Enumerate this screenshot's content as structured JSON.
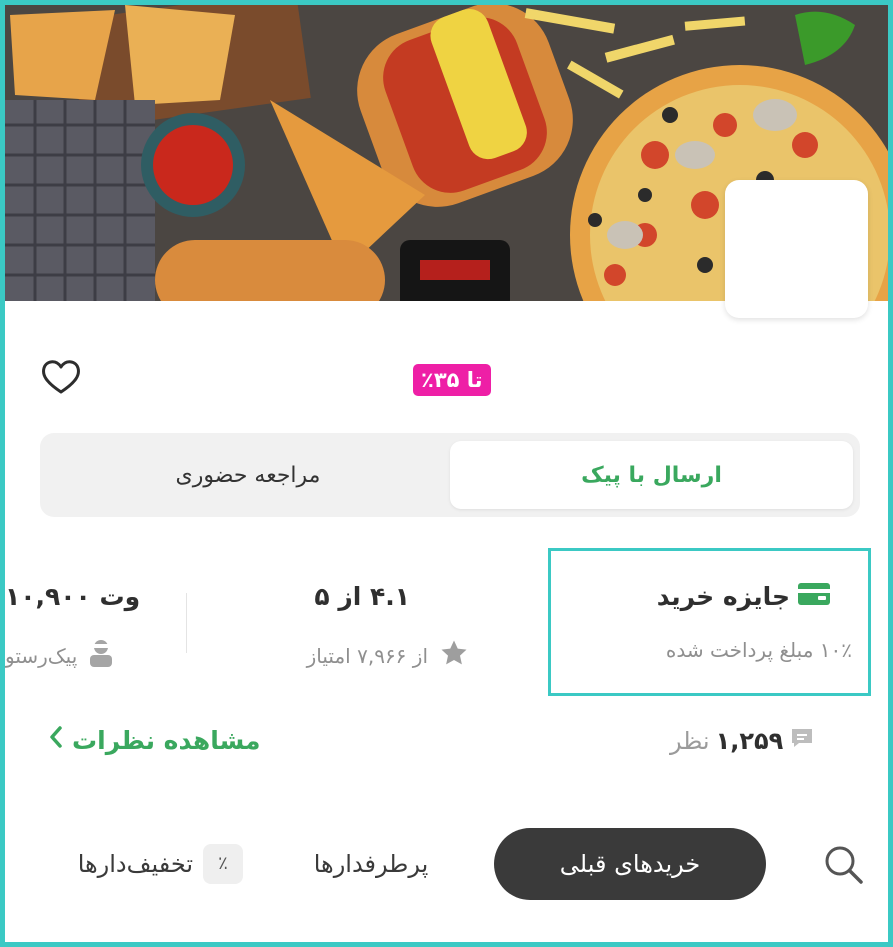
{
  "hero": {
    "image_alt": "pizza and hot dog",
    "logo_placeholder": ""
  },
  "header": {
    "discount_badge": "تا ۳۵٪",
    "favorite_icon": "heart-icon"
  },
  "delivery_mode": {
    "options": [
      {
        "label": "ارسال با پیک",
        "active": true
      },
      {
        "label": "مراجعه حضوری",
        "active": false
      }
    ]
  },
  "info": {
    "reward": {
      "title": "جایزه خرید",
      "subtitle": "۱۰٪ مبلغ پرداخت شده",
      "icon": "wallet-icon"
    },
    "rating": {
      "title": "۴.۱ از ۵",
      "subtitle": "از ۷,۹۶۶ امتیاز",
      "icon": "star-icon"
    },
    "delivery": {
      "title": "۱۰,۹۰۰ تو",
      "subtitle": "پیک‌رستو",
      "icon": "courier-icon"
    }
  },
  "reviews": {
    "count": "۱,۲۵۹",
    "count_suffix": "نظر",
    "see_all": "مشاهده نظرات"
  },
  "tabs": [
    {
      "label": "خریدهای قبلی",
      "active": true
    },
    {
      "label": "پرطرفدارها",
      "active": false
    },
    {
      "label": "تخفیف‌دارها",
      "active": false,
      "chip": "٪"
    }
  ],
  "colors": {
    "accent": "#3aa85e",
    "badge": "#ee1fa6",
    "highlight": "#3bc9c4"
  }
}
